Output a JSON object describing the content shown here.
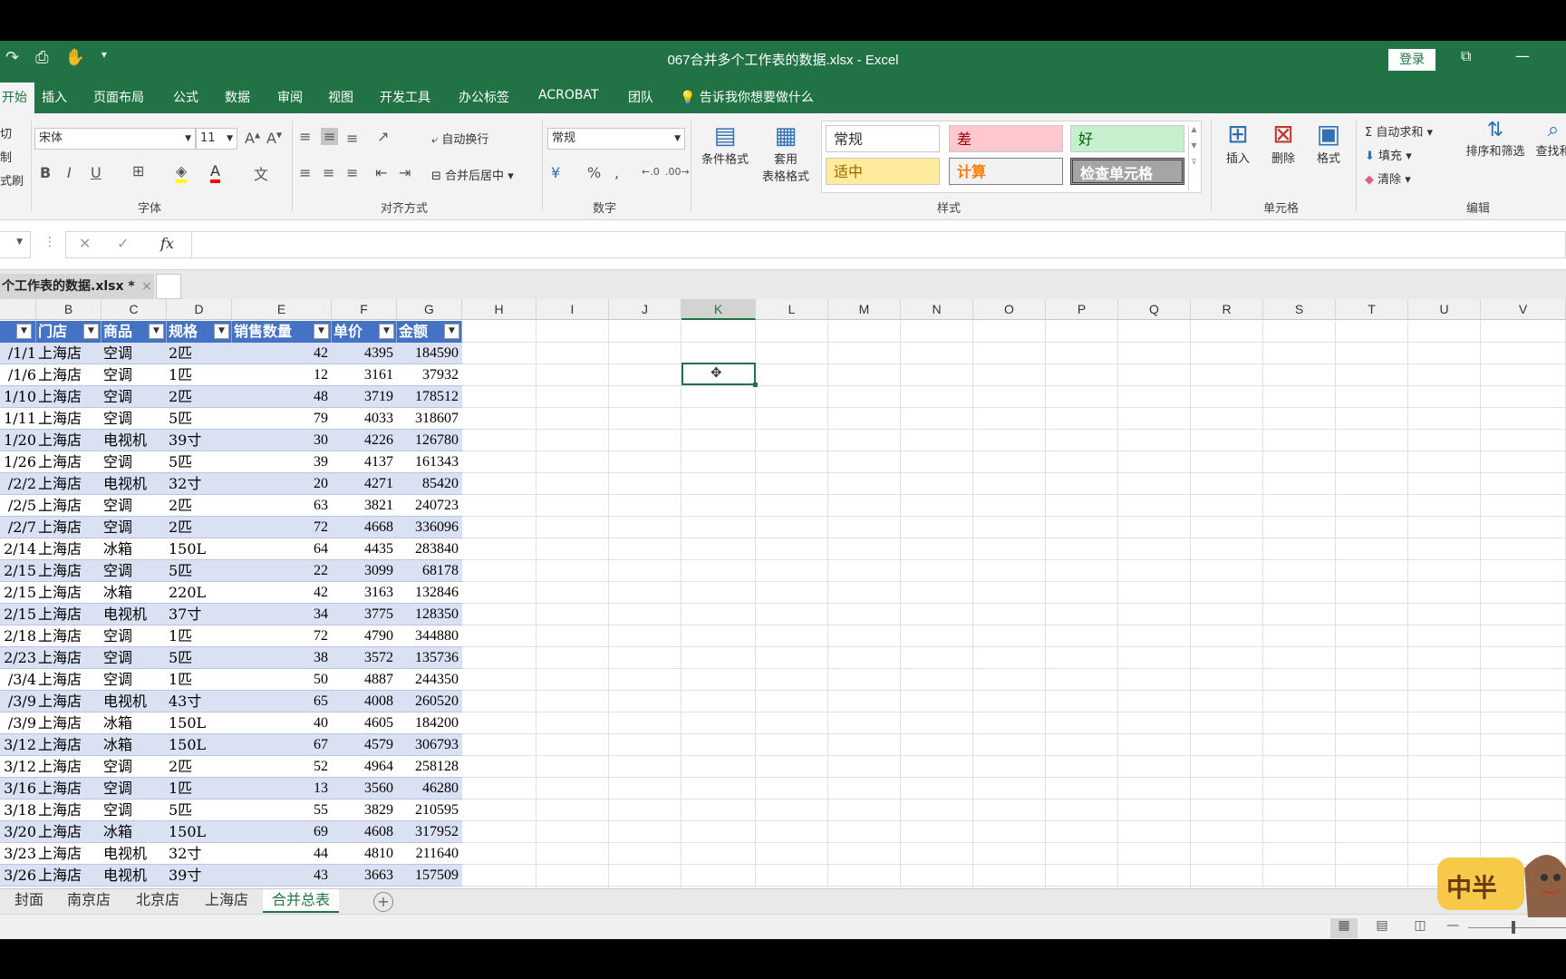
{
  "window": {
    "title": "067合并多个工作表的数据.xlsx  -  Excel",
    "login": "登录"
  },
  "tabs": [
    {
      "label": "开始",
      "active": true
    },
    {
      "label": "插入"
    },
    {
      "label": "页面布局"
    },
    {
      "label": "公式"
    },
    {
      "label": "数据"
    },
    {
      "label": "审阅"
    },
    {
      "label": "视图"
    },
    {
      "label": "开发工具"
    },
    {
      "label": "办公标签"
    },
    {
      "label": "ACROBAT"
    },
    {
      "label": "团队"
    },
    {
      "label": "告诉我你想要做什么"
    }
  ],
  "ribbon": {
    "clipboard": {
      "cut": "切",
      "copy": "制",
      "painter": "式刷"
    },
    "font": {
      "name": "宋体",
      "size": "11",
      "label": "字体"
    },
    "alignment": {
      "wrap": "自动换行",
      "merge": "合并后居中",
      "label": "对齐方式"
    },
    "number": {
      "format": "常规",
      "percent": "%",
      "comma": ",",
      "label": "数字"
    },
    "styles": {
      "cond_format": "条件格式",
      "table_format_1": "套用",
      "table_format_2": "表格格式",
      "cells": [
        {
          "text": "常规",
          "bg": "#ffffff",
          "fg": "#333333"
        },
        {
          "text": "差",
          "bg": "#ffc7ce",
          "fg": "#9c0006"
        },
        {
          "text": "好",
          "bg": "#c6efce",
          "fg": "#006100"
        },
        {
          "text": "适中",
          "bg": "#ffeb9c",
          "fg": "#9c6500"
        },
        {
          "text": "计算",
          "bg": "#f2f2f2",
          "fg": "#fa7d00"
        },
        {
          "text": "检查单元格",
          "bg": "#a5a5a5",
          "fg": "#ffffff"
        }
      ],
      "label": "样式"
    },
    "cells": {
      "insert": "插入",
      "delete": "删除",
      "format": "格式",
      "label": "单元格"
    },
    "editing": {
      "autosum": "自动求和",
      "fill": "填充",
      "clear": "清除",
      "sort": "排序和筛选",
      "find": "查找和",
      "label": "编辑"
    }
  },
  "formula_bar": {
    "fx": "fx",
    "value": ""
  },
  "workbook_tab": "个工作表的数据.xlsx *",
  "columns": [
    "B",
    "C",
    "D",
    "E",
    "F",
    "G",
    "H",
    "I",
    "J",
    "K",
    "L",
    "M",
    "N",
    "O",
    "P",
    "Q",
    "R",
    "S",
    "T",
    "U",
    "V"
  ],
  "selected_column": "K",
  "table_headers": [
    "门店",
    "商品",
    "规格",
    "销售数量",
    "单价",
    "金额"
  ],
  "rows": [
    [
      "/1/1",
      "上海店",
      "空调",
      "2匹",
      "42",
      "4395",
      "184590"
    ],
    [
      "/1/6",
      "上海店",
      "空调",
      "1匹",
      "12",
      "3161",
      "37932"
    ],
    [
      "1/10",
      "上海店",
      "空调",
      "2匹",
      "48",
      "3719",
      "178512"
    ],
    [
      "1/11",
      "上海店",
      "空调",
      "5匹",
      "79",
      "4033",
      "318607"
    ],
    [
      "1/20",
      "上海店",
      "电视机",
      "39寸",
      "30",
      "4226",
      "126780"
    ],
    [
      "1/26",
      "上海店",
      "空调",
      "5匹",
      "39",
      "4137",
      "161343"
    ],
    [
      "/2/2",
      "上海店",
      "电视机",
      "32寸",
      "20",
      "4271",
      "85420"
    ],
    [
      "/2/5",
      "上海店",
      "空调",
      "2匹",
      "63",
      "3821",
      "240723"
    ],
    [
      "/2/7",
      "上海店",
      "空调",
      "2匹",
      "72",
      "4668",
      "336096"
    ],
    [
      "2/14",
      "上海店",
      "冰箱",
      "150L",
      "64",
      "4435",
      "283840"
    ],
    [
      "2/15",
      "上海店",
      "空调",
      "5匹",
      "22",
      "3099",
      "68178"
    ],
    [
      "2/15",
      "上海店",
      "冰箱",
      "220L",
      "42",
      "3163",
      "132846"
    ],
    [
      "2/15",
      "上海店",
      "电视机",
      "37寸",
      "34",
      "3775",
      "128350"
    ],
    [
      "2/18",
      "上海店",
      "空调",
      "1匹",
      "72",
      "4790",
      "344880"
    ],
    [
      "2/23",
      "上海店",
      "空调",
      "5匹",
      "38",
      "3572",
      "135736"
    ],
    [
      "/3/4",
      "上海店",
      "空调",
      "1匹",
      "50",
      "4887",
      "244350"
    ],
    [
      "/3/9",
      "上海店",
      "电视机",
      "43寸",
      "65",
      "4008",
      "260520"
    ],
    [
      "/3/9",
      "上海店",
      "冰箱",
      "150L",
      "40",
      "4605",
      "184200"
    ],
    [
      "3/12",
      "上海店",
      "冰箱",
      "150L",
      "67",
      "4579",
      "306793"
    ],
    [
      "3/12",
      "上海店",
      "空调",
      "2匹",
      "52",
      "4964",
      "258128"
    ],
    [
      "3/16",
      "上海店",
      "空调",
      "1匹",
      "13",
      "3560",
      "46280"
    ],
    [
      "3/18",
      "上海店",
      "空调",
      "5匹",
      "55",
      "3829",
      "210595"
    ],
    [
      "3/20",
      "上海店",
      "冰箱",
      "150L",
      "69",
      "4608",
      "317952"
    ],
    [
      "3/23",
      "上海店",
      "电视机",
      "32寸",
      "44",
      "4810",
      "211640"
    ],
    [
      "3/26",
      "上海店",
      "电视机",
      "39寸",
      "43",
      "3663",
      "157509"
    ]
  ],
  "sheet_tabs": [
    {
      "label": "封面"
    },
    {
      "label": "南京店"
    },
    {
      "label": "北京店"
    },
    {
      "label": "上海店"
    },
    {
      "label": "合并总表",
      "active": true
    }
  ],
  "mascot_text": "中半"
}
